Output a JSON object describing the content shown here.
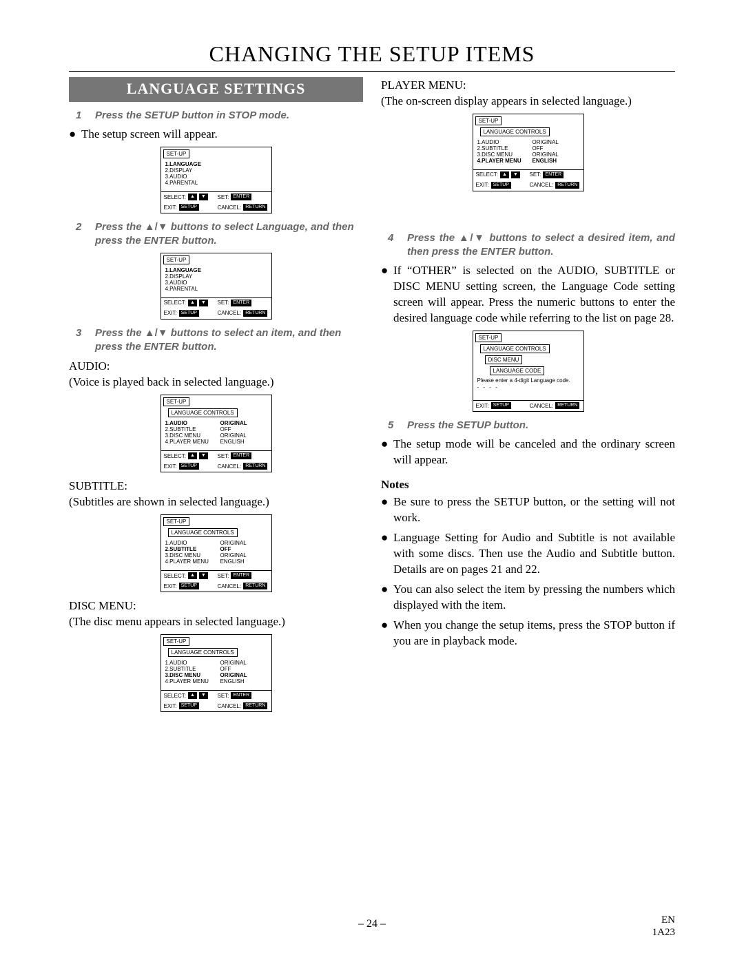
{
  "title": "CHANGING THE SETUP ITEMS",
  "section": "LANGUAGE SETTINGS",
  "steps": {
    "s1": "Press the SETUP button in STOP mode.",
    "s2_a": "Press the ",
    "s2_b": " buttons to select Language, and then press the ENTER button.",
    "s3_a": "Press the ",
    "s3_b": " buttons to select an item, and then press the ENTER button.",
    "s4_a": "Press the ",
    "s4_b": " buttons to select a desired item, and then press the ENTER button.",
    "s5": "Press the SETUP button."
  },
  "body": {
    "after1": "The setup screen will appear.",
    "audio_h": "AUDIO:",
    "audio_t": "(Voice is played back in selected language.)",
    "subtitle_h": "SUBTITLE:",
    "subtitle_t": "(Subtitles are shown in selected language.)",
    "disc_h": "DISC MENU:",
    "disc_t": "(The disc menu appears in selected language.)",
    "player_h": "PLAYER MENU:",
    "player_t": "(The on-screen display appears in selected language.)",
    "after4": "If “OTHER” is selected on the AUDIO, SUBTITLE or DISC MENU setting screen, the Language Code setting screen will appear. Press the numeric buttons to enter the desired language code while referring to the list on page 28.",
    "after5": "The setup mode will be canceled and the ordinary screen will appear."
  },
  "notes_h": "Notes",
  "notes": [
    "Be sure to press the SETUP button, or the setting will not work.",
    "Language Setting for Audio and Subtitle is not available with some discs. Then use the Audio and Subtitle button. Details are on pages 21 and 22.",
    "You can also select the item by pressing the numbers which displayed with the item.",
    "When you change the setup items, press the STOP button if you are in playback mode."
  ],
  "osd": {
    "setup": "SET-UP",
    "lang_controls": "LANGUAGE CONTROLS",
    "disc_menu": "DISC MENU",
    "lang_code": "LANGUAGE CODE",
    "root_items": [
      "1.LANGUAGE",
      "2.DISPLAY",
      "3.AUDIO",
      "4.PARENTAL"
    ],
    "lang_items": [
      {
        "l": "1.AUDIO",
        "r": "ORIGINAL"
      },
      {
        "l": "2.SUBTITLE",
        "r": "OFF"
      },
      {
        "l": "3.DISC MENU",
        "r": "ORIGINAL"
      },
      {
        "l": "4.PLAYER MENU",
        "r": "ENGLISH"
      }
    ],
    "code_msg": "Please enter a 4-digit Language code.",
    "dashes": "- - - -",
    "select": "SELECT:",
    "exit": "EXIT:",
    "set": "SET:",
    "cancel": "CANCEL:",
    "btn_setup": "SETUP",
    "btn_enter": "ENTER",
    "btn_return": "RETURN"
  },
  "page_num": "– 24 –",
  "page_code1": "EN",
  "page_code2": "1A23"
}
